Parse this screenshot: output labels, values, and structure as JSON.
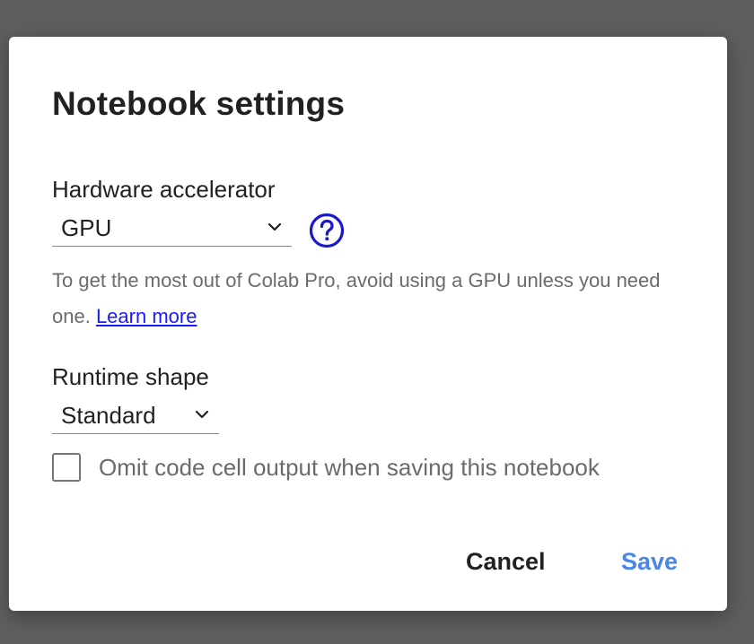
{
  "dialog": {
    "title": "Notebook settings",
    "hardware_accelerator": {
      "label": "Hardware accelerator",
      "value": "GPU",
      "help_icon": "help-circle-icon"
    },
    "hint": {
      "text": "To get the most out of Colab Pro, avoid using a GPU unless you need one. ",
      "link_text": "Learn more"
    },
    "runtime_shape": {
      "label": "Runtime shape",
      "value": "Standard"
    },
    "omit_output": {
      "label": "Omit code cell output when saving this notebook",
      "checked": false
    },
    "buttons": {
      "cancel": "Cancel",
      "save": "Save"
    }
  },
  "colors": {
    "backdrop": "#5f5f5f",
    "link": "#1a1aff",
    "help_icon": "#1a1acc",
    "save": "#4a86e8"
  }
}
